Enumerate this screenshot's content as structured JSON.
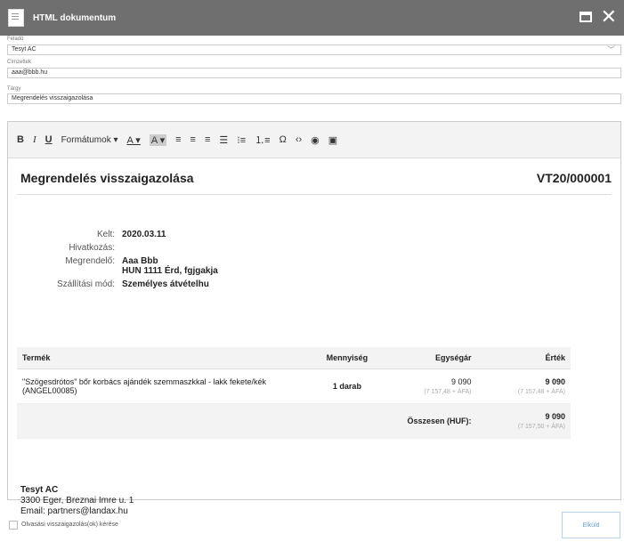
{
  "window": {
    "title": "HTML dokumentum"
  },
  "form": {
    "sender_label": "Feladó",
    "sender_value": "Tesyt AC",
    "recipients_label": "Címzettek",
    "recipients_value": "aaa@bbb.hu",
    "subject_label": "Tárgy",
    "subject_value": "Megrendelés visszaigazolása"
  },
  "toolbar": {
    "bold": "B",
    "italic": "I",
    "underline": "U",
    "formats": "Formátumok ▾",
    "font_color": "A ▾",
    "bg_color": "A ▾"
  },
  "document": {
    "title": "Megrendelés visszaigazolása",
    "number": "VT20/000001",
    "info": {
      "kelt_label": "Kelt:",
      "kelt": "2020.03.11",
      "hivatkozas_label": "Hivatkozás:",
      "hivatkozas": "",
      "megrendelo_label": "Megrendelő:",
      "megrendelo_name": "Aaa Bbb",
      "megrendelo_address": "HUN 1111 Érd, fgjgakja",
      "szallitasi_label": "Szállítási mód:",
      "szallitasi": "Személyes átvételhu"
    },
    "table": {
      "headers": [
        "Termék",
        "Mennyiség",
        "Egységár",
        "Érték"
      ],
      "rows": [
        {
          "product": "\"Szögesdrótos\" bőr korbács ajándék szemmaszkkal - lakk fekete/kék (ANGEL00085)",
          "qty": "1 darab",
          "unit_price": "9 090",
          "unit_price_sub": "(7 157,48 + ÁFA)",
          "value": "9 090",
          "value_sub": "(7 157,48 + ÁFA)"
        }
      ],
      "total_label": "Összesen (HUF):",
      "total": "9 090",
      "total_sub": "(7 157,50 + ÁFA)"
    },
    "footer": {
      "company": "Tesyt AC",
      "address": "3300 Eger, Breznai Imre u. 1",
      "email": "Email: partners@landax.hu"
    }
  },
  "bottom": {
    "read_receipt": "Olvasási visszaigazolás(ok) kérése",
    "send": "Elküld"
  }
}
